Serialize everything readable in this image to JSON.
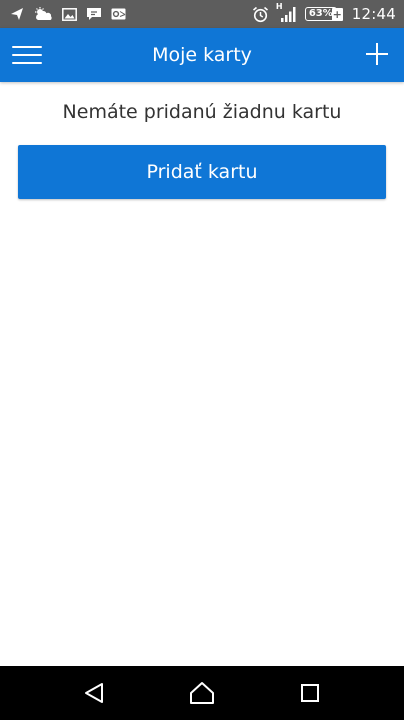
{
  "status_bar": {
    "battery_percent": "63%",
    "battery_plus": "+",
    "network_type": "H",
    "time": "12:44",
    "icons": [
      "navigation-icon",
      "weather-icon",
      "gallery-icon",
      "messenger-icon",
      "outlook-icon",
      "alarm-icon",
      "signal-icon",
      "battery-icon"
    ]
  },
  "app_bar": {
    "title": "Moje karty",
    "menu_icon": "hamburger-menu-icon",
    "add_icon": "plus-icon",
    "color": "#0f76d6"
  },
  "content": {
    "empty_message": "Nemáte pridanú žiadnu kartu",
    "add_button_label": "Pridať kartu"
  },
  "nav_bar": {
    "icons": [
      "back-icon",
      "home-icon",
      "recents-icon"
    ]
  }
}
